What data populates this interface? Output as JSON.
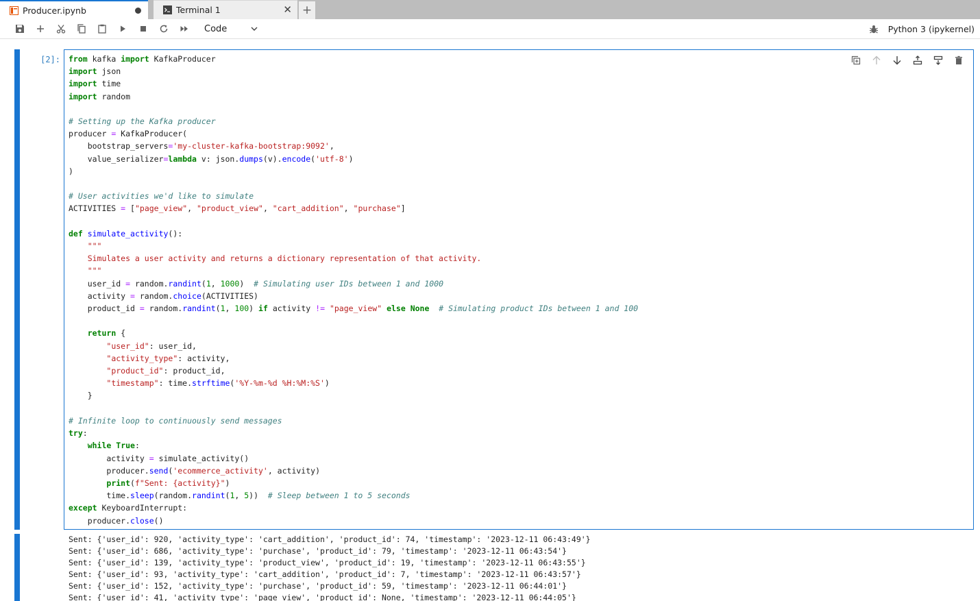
{
  "tabs": [
    {
      "label": "Producer.ipynb",
      "icon": "notebook-icon",
      "active": true,
      "unsaved": true
    },
    {
      "label": "Terminal 1",
      "icon": "terminal-icon",
      "active": false
    }
  ],
  "toolbar": {
    "buttons": [
      "save-icon",
      "add-cell-icon",
      "cut-icon",
      "copy-icon",
      "paste-icon",
      "run-icon",
      "stop-icon",
      "restart-icon",
      "run-all-icon"
    ],
    "cell_type": "Code",
    "kernel": "Python 3 (ipykernel)"
  },
  "cell": {
    "prompt": "[2]:",
    "code_lines": [
      "from kafka import KafkaProducer",
      "import json",
      "import time",
      "import random",
      "",
      "# Setting up the Kafka producer",
      "producer = KafkaProducer(",
      "    bootstrap_servers='my-cluster-kafka-bootstrap:9092',",
      "    value_serializer=lambda v: json.dumps(v).encode('utf-8')",
      ")",
      "",
      "# User activities we'd like to simulate",
      "ACTIVITIES = [\"page_view\", \"product_view\", \"cart_addition\", \"purchase\"]",
      "",
      "def simulate_activity():",
      "    \"\"\"",
      "    Simulates a user activity and returns a dictionary representation of that activity.",
      "    \"\"\"",
      "    user_id = random.randint(1, 1000)  # Simulating user IDs between 1 and 1000",
      "    activity = random.choice(ACTIVITIES)",
      "    product_id = random.randint(1, 100) if activity != \"page_view\" else None  # Simulating product IDs between 1 and 100",
      "",
      "    return {",
      "        \"user_id\": user_id,",
      "        \"activity_type\": activity,",
      "        \"product_id\": product_id,",
      "        \"timestamp\": time.strftime('%Y-%m-%d %H:%M:%S')",
      "    }",
      "",
      "# Infinite loop to continuously send messages",
      "try:",
      "    while True:",
      "        activity = simulate_activity()",
      "        producer.send('ecommerce_activity', activity)",
      "        print(f\"Sent: {activity}\")",
      "        time.sleep(random.randint(1, 5))  # Sleep between 1 to 5 seconds",
      "except KeyboardInterrupt:",
      "    producer.close()"
    ],
    "cell_toolbar": [
      "duplicate-icon",
      "move-up-icon",
      "move-down-icon",
      "insert-above-icon",
      "insert-below-icon",
      "delete-icon"
    ]
  },
  "output_lines": [
    "Sent: {'user_id': 920, 'activity_type': 'cart_addition', 'product_id': 74, 'timestamp': '2023-12-11 06:43:49'}",
    "Sent: {'user_id': 686, 'activity_type': 'purchase', 'product_id': 79, 'timestamp': '2023-12-11 06:43:54'}",
    "Sent: {'user_id': 139, 'activity_type': 'product_view', 'product_id': 19, 'timestamp': '2023-12-11 06:43:55'}",
    "Sent: {'user_id': 93, 'activity_type': 'cart_addition', 'product_id': 7, 'timestamp': '2023-12-11 06:43:57'}",
    "Sent: {'user_id': 152, 'activity_type': 'purchase', 'product_id': 59, 'timestamp': '2023-12-11 06:44:01'}",
    "Sent: {'user_id': 41, 'activity_type': 'page_view', 'product_id': None, 'timestamp': '2023-12-11 06:44:05'}"
  ],
  "colors": {
    "accent": "#1976d2",
    "keyword": "#008000",
    "comment": "#408080",
    "string": "#ba2121",
    "prompt": "#307fc1"
  }
}
